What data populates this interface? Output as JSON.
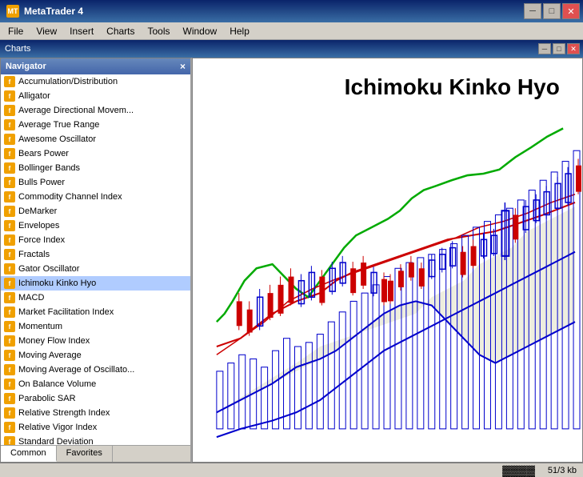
{
  "window": {
    "title": "MetaTrader 4",
    "app_icon": "MT",
    "controls": {
      "minimize": "─",
      "maximize": "□",
      "close": "✕"
    }
  },
  "menu": {
    "items": [
      "File",
      "View",
      "Insert",
      "Charts",
      "Tools",
      "Window",
      "Help"
    ]
  },
  "inner_window": {
    "title": "Charts",
    "controls": {
      "minimize": "─",
      "maximize": "□",
      "close": "✕"
    }
  },
  "navigator": {
    "title": "Navigator",
    "close_btn": "×",
    "items": [
      "Accumulation/Distribution",
      "Alligator",
      "Average Directional Movem...",
      "Average True Range",
      "Awesome Oscillator",
      "Bears Power",
      "Bollinger Bands",
      "Bulls Power",
      "Commodity Channel Index",
      "DeMarker",
      "Envelopes",
      "Force Index",
      "Fractals",
      "Gator Oscillator",
      "Ichimoku Kinko Hyo",
      "MACD",
      "Market Facilitation Index",
      "Momentum",
      "Money Flow Index",
      "Moving Average",
      "Moving Average of Oscillato...",
      "On Balance Volume",
      "Parabolic SAR",
      "Relative Strength Index",
      "Relative Vigor Index",
      "Standard Deviation"
    ],
    "tabs": [
      "Common",
      "Favorites"
    ]
  },
  "chart": {
    "title": "Ichimoku Kinko Hyo"
  },
  "status_bar": {
    "icon": "▓▓▓▓",
    "size": "51/3 kb"
  }
}
